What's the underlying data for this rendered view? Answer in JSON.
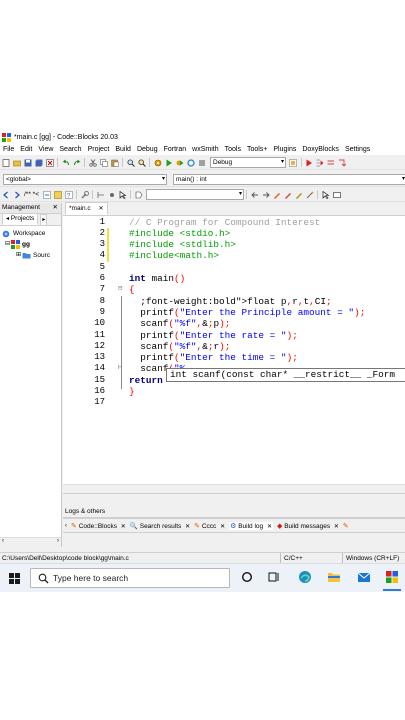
{
  "window": {
    "title": "*main.c [gg] - Code::Blocks 20.03"
  },
  "menu": [
    "File",
    "Edit",
    "View",
    "Search",
    "Project",
    "Build",
    "Debug",
    "Fortran",
    "wxSmith",
    "Tools",
    "Tools+",
    "Plugins",
    "DoxyBlocks",
    "Settings"
  ],
  "toolbar": {
    "build_target": "Debug",
    "scope": "<global>",
    "function": "main() : int",
    "comment_label": "/** *<"
  },
  "management": {
    "title": "Management",
    "tabs": [
      "Projects",
      "S"
    ],
    "tree": {
      "workspace": "Workspace",
      "project": "gg",
      "folder": "Sourc"
    }
  },
  "editor": {
    "tab": "*main.c",
    "line_numbers": [
      "1",
      "2",
      "3",
      "4",
      "5",
      "6",
      "7",
      "8",
      "9",
      "10",
      "11",
      "12",
      "13",
      "14",
      "15",
      "16",
      "17"
    ],
    "lines": [
      "// C Program for Compound Interest",
      "#include <stdio.h>",
      "#include <stdlib.h>",
      "#include<math.h>",
      "",
      "int main()",
      "{",
      "  float p,r,t,CI;",
      "  printf(\"Enter the Principle amount = \");",
      "  scanf(\"%f\",&p);",
      "  printf(\"Enter the rate = \");",
      "  scanf(\"%f\",&r);",
      "  printf(\"Enter the time = \");",
      "  scanf(\"%_",
      "return",
      "}",
      ""
    ],
    "calltip": "int scanf(const char* __restrict__ _Form"
  },
  "logs": {
    "title": "Logs & others",
    "tabs": [
      "Code::Blocks",
      "Search results",
      "Cccc",
      "Build log",
      "Build messages"
    ]
  },
  "status": {
    "path": "C:\\Users\\Dell\\Desktop\\code block\\gg\\main.c",
    "language": "C/C++",
    "line_endings": "Windows (CR+LF)"
  },
  "taskbar": {
    "search_placeholder": "Type here to search"
  },
  "colors": {
    "comment": "#a0a0a0",
    "preprocessor": "#00a000",
    "keyword": "#000080",
    "string": "#0000ff",
    "operator": "#ff0000"
  }
}
